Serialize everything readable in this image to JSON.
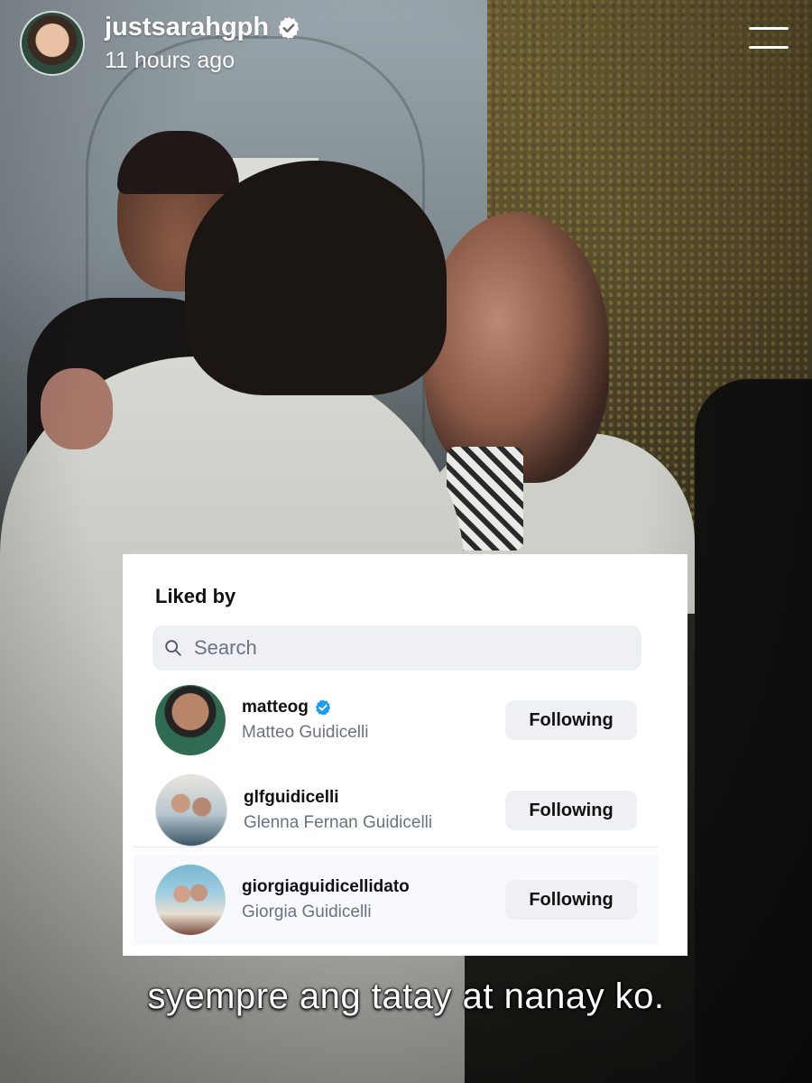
{
  "story": {
    "username": "justsarahgph",
    "verified": true,
    "timestamp": "11 hours ago",
    "caption": "syempre ang tatay at nanay ko."
  },
  "liked_by": {
    "title": "Liked by",
    "search_placeholder": "Search",
    "users": [
      {
        "handle": "matteog",
        "verified": true,
        "full_name": "Matteo Guidicelli",
        "button": "Following"
      },
      {
        "handle": "glfguidicelli",
        "verified": false,
        "full_name": "Glenna Fernan Guidicelli",
        "button": "Following"
      },
      {
        "handle": "giorgiaguidicellidato",
        "verified": false,
        "full_name": "Giorgia Guidicelli",
        "button": "Following"
      }
    ]
  },
  "icons": {
    "verified": "verified-badge-icon",
    "menu": "menu-icon",
    "search": "search-icon"
  },
  "colors": {
    "verified_blue": "#1d9bf0",
    "button_bg": "#eef0f4",
    "card_bg": "#ffffff"
  }
}
